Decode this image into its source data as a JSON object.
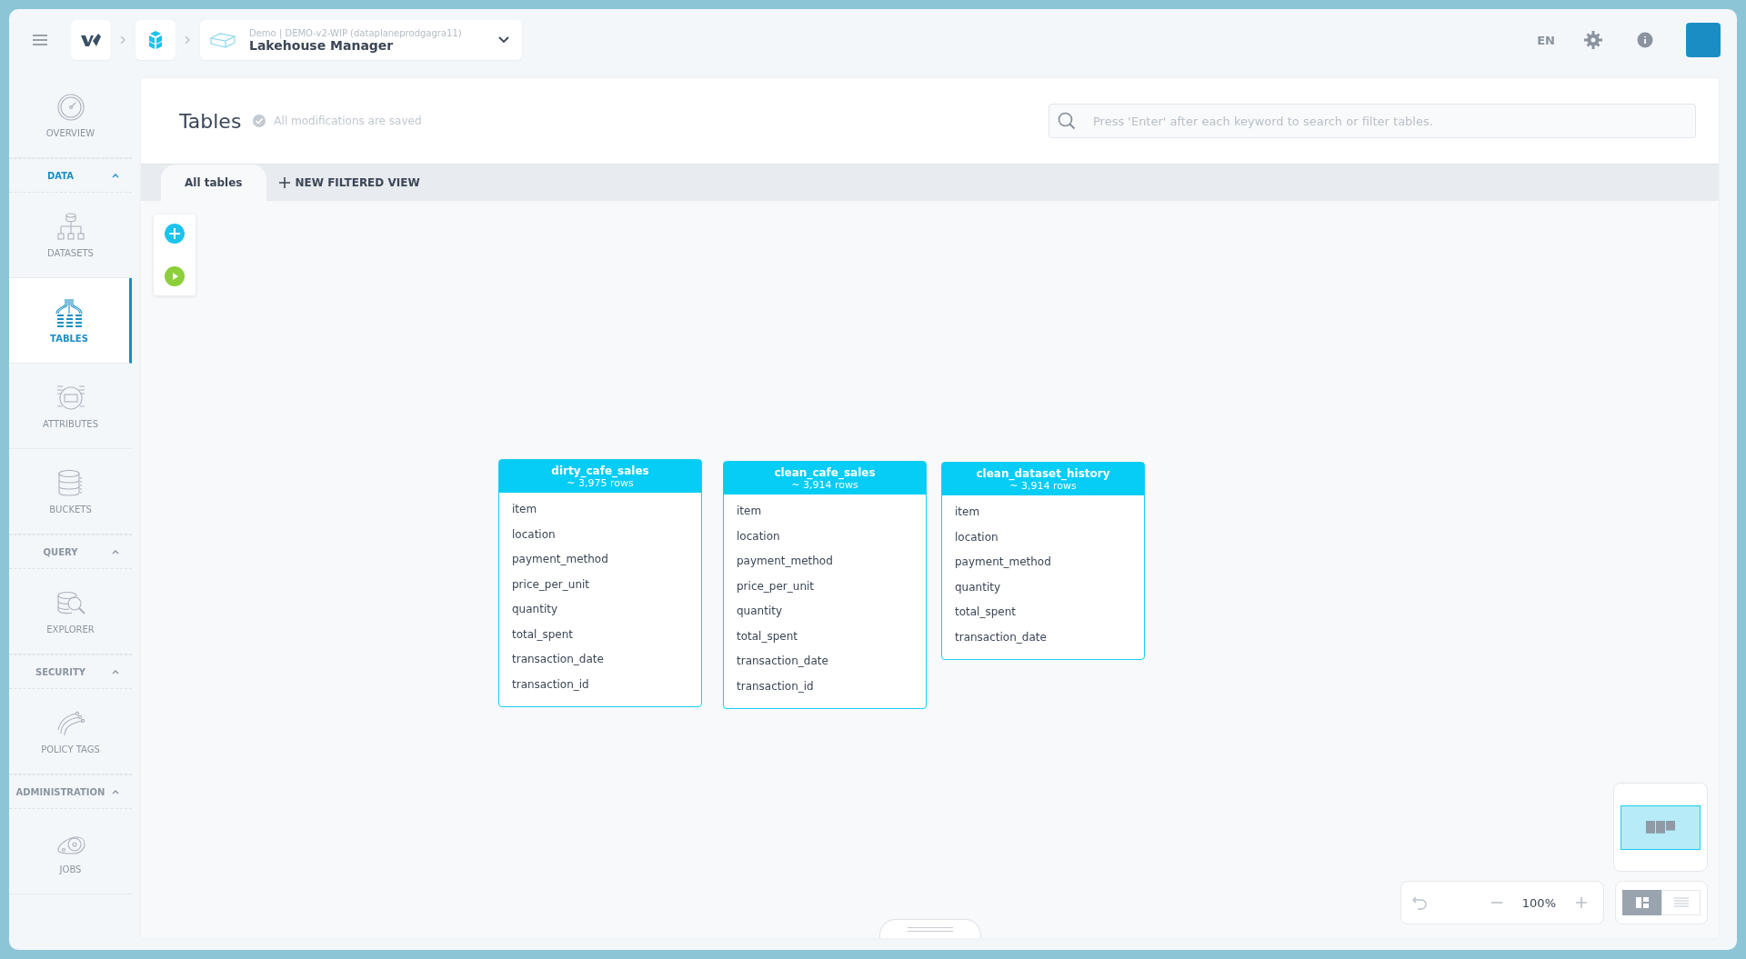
{
  "topbar": {
    "breadcrumb_context": "Demo | DEMO-v2-WIP (dataplaneprodgagra11)",
    "app_title": "Lakehouse Manager",
    "language": "EN"
  },
  "sidebar": {
    "items": [
      {
        "kind": "item",
        "label": "OVERVIEW",
        "selected": false
      },
      {
        "kind": "section",
        "label": "DATA",
        "expanded": true,
        "selected": true
      },
      {
        "kind": "item",
        "label": "DATASETS",
        "selected": false
      },
      {
        "kind": "item",
        "label": "TABLES",
        "selected": true
      },
      {
        "kind": "item",
        "label": "ATTRIBUTES",
        "selected": false
      },
      {
        "kind": "item",
        "label": "BUCKETS",
        "selected": false
      },
      {
        "kind": "section",
        "label": "QUERY",
        "expanded": true,
        "selected": false
      },
      {
        "kind": "item",
        "label": "EXPLORER",
        "selected": false
      },
      {
        "kind": "section",
        "label": "SECURITY",
        "expanded": true,
        "selected": false
      },
      {
        "kind": "item",
        "label": "POLICY TAGS",
        "selected": false
      },
      {
        "kind": "section",
        "label": "ADMINISTRATION",
        "expanded": true,
        "selected": false
      },
      {
        "kind": "item",
        "label": "JOBS",
        "selected": false
      }
    ]
  },
  "header": {
    "title": "Tables",
    "save_status": "All modifications are saved",
    "search": {
      "placeholder": "Press 'Enter' after each keyword to search or filter tables."
    }
  },
  "tabs": [
    {
      "label": "All tables",
      "selected": true
    },
    {
      "label": "NEW FILTERED VIEW",
      "selected": false
    }
  ],
  "tables": [
    {
      "name": "dirty_cafe_sales",
      "rows": "~ 3,975 rows",
      "columns": [
        "item",
        "location",
        "payment_method",
        "price_per_unit",
        "quantity",
        "total_spent",
        "transaction_date",
        "transaction_id"
      ]
    },
    {
      "name": "clean_cafe_sales",
      "rows": "~ 3,914 rows",
      "columns": [
        "item",
        "location",
        "payment_method",
        "price_per_unit",
        "quantity",
        "total_spent",
        "transaction_date",
        "transaction_id"
      ]
    },
    {
      "name": "clean_dataset_history",
      "rows": "~ 3,914 rows",
      "columns": [
        "item",
        "location",
        "payment_method",
        "quantity",
        "total_spent",
        "transaction_date"
      ]
    }
  ],
  "zoom": "100%",
  "view_modes": [
    {
      "kind": "graph",
      "selected": true
    },
    {
      "kind": "list",
      "selected": false
    }
  ]
}
